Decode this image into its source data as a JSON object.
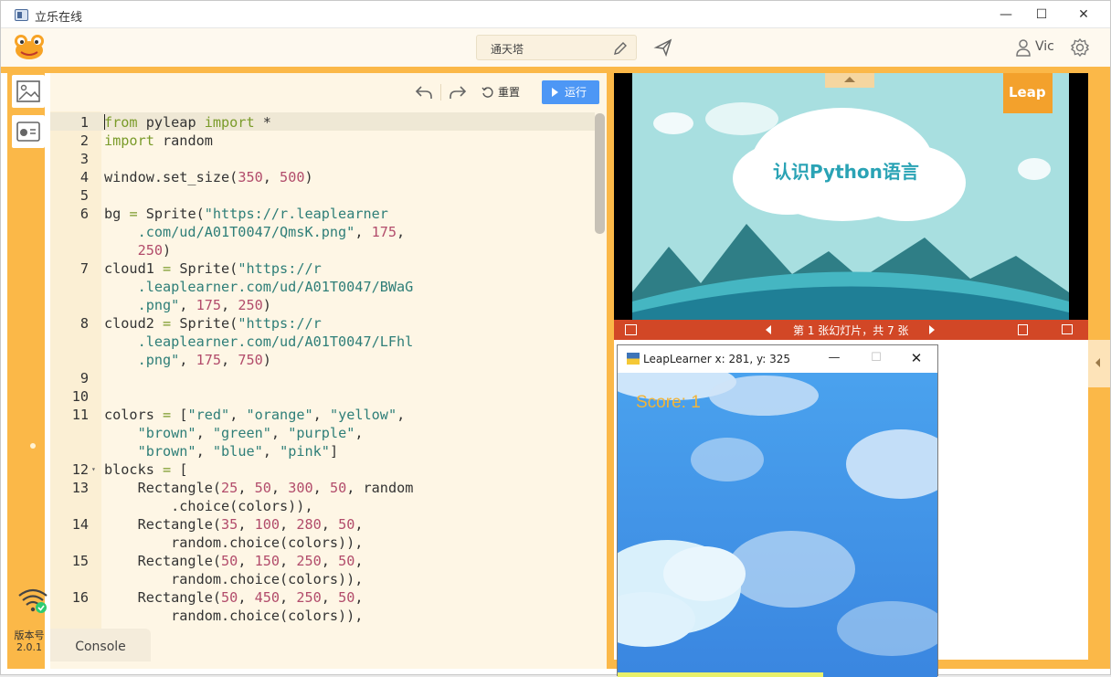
{
  "window": {
    "title": "立乐在线",
    "minimize": "—",
    "maximize": "☐",
    "close": "✕"
  },
  "toolbar": {
    "project_name": "通天塔",
    "user_name": "Vic"
  },
  "left_rail": {
    "version_label": "版本号",
    "version_number": "2.0.1"
  },
  "editor": {
    "reset_label": "重置",
    "run_label": "运行",
    "console_tab": "Console",
    "lines": [
      {
        "n": "1",
        "fold": "",
        "code": [
          [
            "kw",
            "from"
          ],
          [
            "op",
            " pyleap "
          ],
          [
            "kw",
            "import"
          ],
          [
            "op",
            " *"
          ]
        ]
      },
      {
        "n": "2",
        "fold": "",
        "code": [
          [
            "kw",
            "import"
          ],
          [
            "op",
            " random"
          ]
        ]
      },
      {
        "n": "3",
        "fold": "",
        "code": []
      },
      {
        "n": "4",
        "fold": "",
        "code": [
          [
            "op",
            "window.set_size("
          ],
          [
            "num",
            "350"
          ],
          [
            "op",
            ", "
          ],
          [
            "num",
            "500"
          ],
          [
            "op",
            ")"
          ]
        ]
      },
      {
        "n": "5",
        "fold": "",
        "code": []
      },
      {
        "n": "6",
        "fold": "",
        "code": [
          [
            "op",
            "bg "
          ],
          [
            "kw",
            "="
          ],
          [
            "op",
            " Sprite("
          ],
          [
            "str",
            "\"https://r.leaplearner"
          ]
        ]
      },
      {
        "n": "",
        "fold": "",
        "code": [
          [
            "str",
            "    .com/ud/A01T0047/QmsK.png\""
          ],
          [
            "op",
            ", "
          ],
          [
            "num",
            "175"
          ],
          [
            "op",
            ","
          ]
        ]
      },
      {
        "n": "",
        "fold": "",
        "code": [
          [
            "num",
            "    250"
          ],
          [
            "op",
            ")"
          ]
        ]
      },
      {
        "n": "7",
        "fold": "",
        "code": [
          [
            "op",
            "cloud1 "
          ],
          [
            "kw",
            "="
          ],
          [
            "op",
            " Sprite("
          ],
          [
            "str",
            "\"https://r"
          ]
        ]
      },
      {
        "n": "",
        "fold": "",
        "code": [
          [
            "str",
            "    .leaplearner.com/ud/A01T0047/BWaG"
          ]
        ]
      },
      {
        "n": "",
        "fold": "",
        "code": [
          [
            "str",
            "    .png\""
          ],
          [
            "op",
            ", "
          ],
          [
            "num",
            "175"
          ],
          [
            "op",
            ", "
          ],
          [
            "num",
            "250"
          ],
          [
            "op",
            ")"
          ]
        ]
      },
      {
        "n": "8",
        "fold": "",
        "code": [
          [
            "op",
            "cloud2 "
          ],
          [
            "kw",
            "="
          ],
          [
            "op",
            " Sprite("
          ],
          [
            "str",
            "\"https://r"
          ]
        ]
      },
      {
        "n": "",
        "fold": "",
        "code": [
          [
            "str",
            "    .leaplearner.com/ud/A01T0047/LFhl"
          ]
        ]
      },
      {
        "n": "",
        "fold": "",
        "code": [
          [
            "str",
            "    .png\""
          ],
          [
            "op",
            ", "
          ],
          [
            "num",
            "175"
          ],
          [
            "op",
            ", "
          ],
          [
            "num",
            "750"
          ],
          [
            "op",
            ")"
          ]
        ]
      },
      {
        "n": "9",
        "fold": "",
        "code": []
      },
      {
        "n": "10",
        "fold": "",
        "code": []
      },
      {
        "n": "11",
        "fold": "",
        "code": [
          [
            "op",
            "colors "
          ],
          [
            "kw",
            "="
          ],
          [
            "op",
            " ["
          ],
          [
            "str",
            "\"red\""
          ],
          [
            "op",
            ", "
          ],
          [
            "str",
            "\"orange\""
          ],
          [
            "op",
            ", "
          ],
          [
            "str",
            "\"yellow\""
          ],
          [
            "op",
            ","
          ]
        ]
      },
      {
        "n": "",
        "fold": "",
        "code": [
          [
            "str",
            "    \"brown\""
          ],
          [
            "op",
            ", "
          ],
          [
            "str",
            "\"green\""
          ],
          [
            "op",
            ", "
          ],
          [
            "str",
            "\"purple\""
          ],
          [
            "op",
            ","
          ]
        ]
      },
      {
        "n": "",
        "fold": "",
        "code": [
          [
            "str",
            "    \"brown\""
          ],
          [
            "op",
            ", "
          ],
          [
            "str",
            "\"blue\""
          ],
          [
            "op",
            ", "
          ],
          [
            "str",
            "\"pink\""
          ],
          [
            "op",
            "]"
          ]
        ]
      },
      {
        "n": "12",
        "fold": "▾",
        "code": [
          [
            "op",
            "blocks "
          ],
          [
            "kw",
            "="
          ],
          [
            "op",
            " ["
          ]
        ]
      },
      {
        "n": "13",
        "fold": "",
        "code": [
          [
            "op",
            "    Rectangle("
          ],
          [
            "num",
            "25"
          ],
          [
            "op",
            ", "
          ],
          [
            "num",
            "50"
          ],
          [
            "op",
            ", "
          ],
          [
            "num",
            "300"
          ],
          [
            "op",
            ", "
          ],
          [
            "num",
            "50"
          ],
          [
            "op",
            ", random"
          ]
        ]
      },
      {
        "n": "",
        "fold": "",
        "code": [
          [
            "op",
            "        .choice(colors)),"
          ]
        ]
      },
      {
        "n": "14",
        "fold": "",
        "code": [
          [
            "op",
            "    Rectangle("
          ],
          [
            "num",
            "35"
          ],
          [
            "op",
            ", "
          ],
          [
            "num",
            "100"
          ],
          [
            "op",
            ", "
          ],
          [
            "num",
            "280"
          ],
          [
            "op",
            ", "
          ],
          [
            "num",
            "50"
          ],
          [
            "op",
            ","
          ]
        ]
      },
      {
        "n": "",
        "fold": "",
        "code": [
          [
            "op",
            "        random.choice(colors)),"
          ]
        ]
      },
      {
        "n": "15",
        "fold": "",
        "code": [
          [
            "op",
            "    Rectangle("
          ],
          [
            "num",
            "50"
          ],
          [
            "op",
            ", "
          ],
          [
            "num",
            "150"
          ],
          [
            "op",
            ", "
          ],
          [
            "num",
            "250"
          ],
          [
            "op",
            ", "
          ],
          [
            "num",
            "50"
          ],
          [
            "op",
            ","
          ]
        ]
      },
      {
        "n": "",
        "fold": "",
        "code": [
          [
            "op",
            "        random.choice(colors)),"
          ]
        ]
      },
      {
        "n": "16",
        "fold": "",
        "code": [
          [
            "op",
            "    Rectangle("
          ],
          [
            "num",
            "50"
          ],
          [
            "op",
            ", "
          ],
          [
            "num",
            "450"
          ],
          [
            "op",
            ", "
          ],
          [
            "num",
            "250"
          ],
          [
            "op",
            ", "
          ],
          [
            "num",
            "50"
          ],
          [
            "op",
            ","
          ]
        ]
      },
      {
        "n": "",
        "fold": "",
        "code": [
          [
            "op",
            "        random.choice(colors)),"
          ]
        ]
      }
    ]
  },
  "slide": {
    "heading": "认识Python语言",
    "brand": "Leap",
    "counter": "第 1 张幻灯片，共 7 张"
  },
  "game": {
    "title": "LeapLearner  x: 281, y: 325",
    "score": "Score: 1"
  },
  "colors": {
    "accent_orange": "#fbb848",
    "run_blue": "#4d97f5",
    "ppt_red": "#d24726",
    "sky_blue": "#3f8fe6"
  }
}
